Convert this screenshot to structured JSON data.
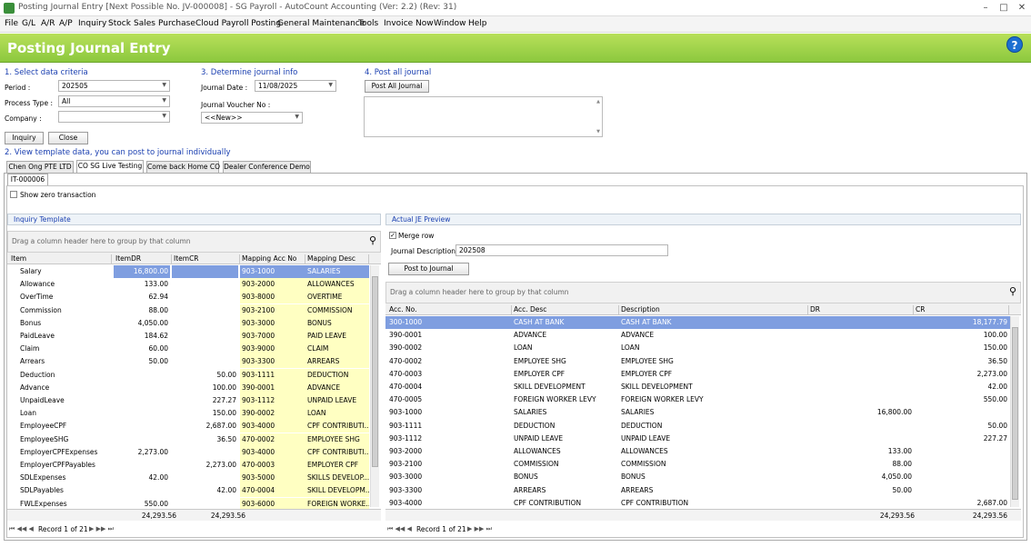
{
  "window": {
    "title": "Posting Journal Entry [Next Possible No. JV-000008] - SG Payroll - AutoCount Accounting (Ver: 2.2) (Rev: 31)",
    "min": "–",
    "restore": "□",
    "close": "✕"
  },
  "menu": [
    "File",
    "G/L",
    "A/R",
    "A/P",
    "Inquiry",
    "Stock",
    "Sales",
    "Purchase",
    "Cloud Payroll Posting",
    "General Maintenance",
    "Tools",
    "Invoice Now",
    "Window",
    "Help"
  ],
  "header": {
    "title": "Posting Journal Entry",
    "help": "?"
  },
  "section1": {
    "title": "1. Select data criteria",
    "period_label": "Period :",
    "period_value": "202505",
    "process_label": "Process Type :",
    "process_value": "All",
    "company_label": "Company :",
    "company_value": "",
    "inquiry_button": "Inquiry",
    "close_button": "Close"
  },
  "section3": {
    "title": "3. Determine journal info",
    "date_label": "Journal Date :",
    "date_value": "11/08/2025",
    "voucher_label": "Journal Voucher No :",
    "voucher_value": "<<New>>"
  },
  "section4": {
    "title": "4. Post all journal",
    "post_all_button": "Post All Journal"
  },
  "section2": {
    "title": "2. View template data, you can post to journal individually"
  },
  "tabs": [
    "Chen Ong PTE LTD",
    "CO SG Live Testing",
    "Come back Home CO",
    "Dealer Conference Demo"
  ],
  "subtab": "IT-000006",
  "show_zero": "Show zero transaction",
  "left": {
    "panel_title": "Inquiry Template",
    "group_hint": "Drag a column header here to group by that column",
    "columns": [
      "Item",
      "ItemDR",
      "ItemCR",
      "Mapping Acc No",
      "Mapping Desc"
    ],
    "rows": [
      [
        "Salary",
        "16,800.00",
        "",
        "903-1000",
        "SALARIES"
      ],
      [
        "Allowance",
        "133.00",
        "",
        "903-2000",
        "ALLOWANCES"
      ],
      [
        "OverTime",
        "62.94",
        "",
        "903-8000",
        "OVERTIME"
      ],
      [
        "Commission",
        "88.00",
        "",
        "903-2100",
        "COMMISSION"
      ],
      [
        "Bonus",
        "4,050.00",
        "",
        "903-3000",
        "BONUS"
      ],
      [
        "PaidLeave",
        "184.62",
        "",
        "903-7000",
        "PAID LEAVE"
      ],
      [
        "Claim",
        "60.00",
        "",
        "903-9000",
        "CLAIM"
      ],
      [
        "Arrears",
        "50.00",
        "",
        "903-3300",
        "ARREARS"
      ],
      [
        "Deduction",
        "",
        "50.00",
        "903-1111",
        "DEDUCTION"
      ],
      [
        "Advance",
        "",
        "100.00",
        "390-0001",
        "ADVANCE"
      ],
      [
        "UnpaidLeave",
        "",
        "227.27",
        "903-1112",
        "UNPAID LEAVE"
      ],
      [
        "Loan",
        "",
        "150.00",
        "390-0002",
        "LOAN"
      ],
      [
        "EmployeeCPF",
        "",
        "2,687.00",
        "903-4000",
        "CPF CONTRIBUTI..."
      ],
      [
        "EmployeeSHG",
        "",
        "36.50",
        "470-0002",
        "EMPLOYEE SHG"
      ],
      [
        "EmployerCPFExpenses",
        "2,273.00",
        "",
        "903-4000",
        "CPF CONTRIBUTI..."
      ],
      [
        "EmployerCPFPayables",
        "",
        "2,273.00",
        "470-0003",
        "EMPLOYER CPF"
      ],
      [
        "SDLExpenses",
        "42.00",
        "",
        "903-5000",
        "SKILLS DEVELOP..."
      ],
      [
        "SDLPayables",
        "",
        "42.00",
        "470-0004",
        "SKILL DEVELOPM..."
      ],
      [
        "FWLExpenses",
        "550.00",
        "",
        "903-6000",
        "FOREIGN WORKE..."
      ]
    ],
    "total_dr": "24,293.56",
    "total_cr": "24,293.56",
    "record": "Record 1 of 21"
  },
  "right": {
    "panel_title": "Actual JE Preview",
    "merge_row": "Merge row",
    "desc_label": "Journal Description :",
    "desc_value": "202508",
    "post_button": "Post to Journal",
    "group_hint": "Drag a column header here to group by that column",
    "columns": [
      "Acc. No.",
      "Acc. Desc",
      "Description",
      "DR",
      "CR"
    ],
    "rows": [
      [
        "300-1000",
        "CASH AT BANK",
        "CASH AT BANK",
        "",
        "18,177.79"
      ],
      [
        "390-0001",
        "ADVANCE",
        "ADVANCE",
        "",
        "100.00"
      ],
      [
        "390-0002",
        "LOAN",
        "LOAN",
        "",
        "150.00"
      ],
      [
        "470-0002",
        "EMPLOYEE SHG",
        "EMPLOYEE SHG",
        "",
        "36.50"
      ],
      [
        "470-0003",
        "EMPLOYER CPF",
        "EMPLOYER CPF",
        "",
        "2,273.00"
      ],
      [
        "470-0004",
        "SKILL DEVELOPMENT",
        "SKILL DEVELOPMENT",
        "",
        "42.00"
      ],
      [
        "470-0005",
        "FOREIGN WORKER LEVY",
        "FOREIGN WORKER LEVY",
        "",
        "550.00"
      ],
      [
        "903-1000",
        "SALARIES",
        "SALARIES",
        "16,800.00",
        ""
      ],
      [
        "903-1111",
        "DEDUCTION",
        "DEDUCTION",
        "",
        "50.00"
      ],
      [
        "903-1112",
        "UNPAID LEAVE",
        "UNPAID LEAVE",
        "",
        "227.27"
      ],
      [
        "903-2000",
        "ALLOWANCES",
        "ALLOWANCES",
        "133.00",
        ""
      ],
      [
        "903-2100",
        "COMMISSION",
        "COMMISSION",
        "88.00",
        ""
      ],
      [
        "903-3000",
        "BONUS",
        "BONUS",
        "4,050.00",
        ""
      ],
      [
        "903-3300",
        "ARREARS",
        "ARREARS",
        "50.00",
        ""
      ],
      [
        "903-4000",
        "CPF CONTRIBUTION",
        "CPF CONTRIBUTION",
        "",
        "2,687.00"
      ]
    ],
    "total_dr": "24,293.56",
    "total_cr": "24,293.56",
    "record": "Record 1 of 21"
  },
  "colors": {
    "header_green": "#8cc83e",
    "selection": "#7f9ee0",
    "mapping_yellow": "#ffffc2",
    "section_blue": "#1a3fb0"
  }
}
